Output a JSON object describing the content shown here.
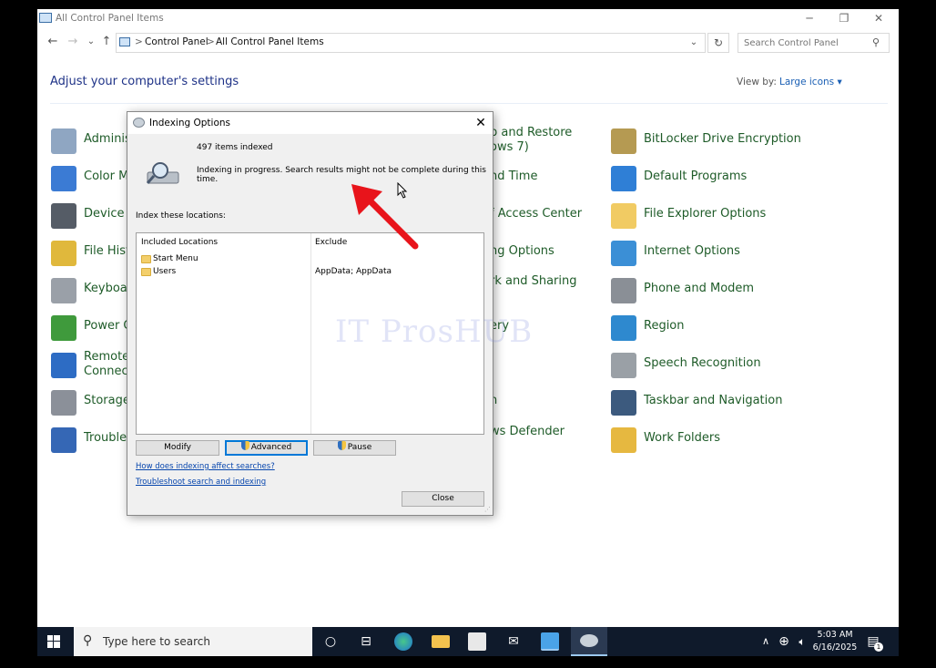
{
  "window": {
    "title": "All Control Panel Items",
    "minimize": "─",
    "restore": "❐",
    "close": "✕"
  },
  "nav": {
    "back": "←",
    "forward": "→",
    "recent": "⌄",
    "up": "↑",
    "breadcrumb": [
      "Control Panel",
      "All Control Panel Items"
    ],
    "separator": ">",
    "search_placeholder": "Search Control Panel"
  },
  "main": {
    "heading": "Adjust your computer's settings",
    "view_by_label": "View by:",
    "view_by_value": "Large icons"
  },
  "items_col1": [
    {
      "label": "Adminis",
      "icon": "admin-tools-icon",
      "color": "#8fa6c2"
    },
    {
      "label": "Color M",
      "icon": "color-management-icon",
      "color": "#3b7bd4"
    },
    {
      "label": "Device M",
      "icon": "device-manager-icon",
      "color": "#555c66"
    },
    {
      "label": "File Histo",
      "icon": "file-history-icon",
      "color": "#e0b83c"
    },
    {
      "label": "Keyboar",
      "icon": "keyboard-icon",
      "color": "#9aa0a8"
    },
    {
      "label": "Power O",
      "icon": "power-options-icon",
      "color": "#3f9a3c"
    },
    {
      "label": "RemoteA\nConnect",
      "icon": "remoteapp-icon",
      "color": "#2d6cc4"
    },
    {
      "label": "Storage",
      "icon": "storage-spaces-icon",
      "color": "#8b9099"
    },
    {
      "label": "Troubles",
      "icon": "troubleshooting-icon",
      "color": "#3567b5"
    }
  ],
  "items_col2": [
    {
      "label": "p and Restore\nows 7)"
    },
    {
      "label": "nd Time"
    },
    {
      "label": "f Access Center"
    },
    {
      "label": "ng Options"
    },
    {
      "label": "rk and Sharing"
    },
    {
      "label": "ery"
    },
    {
      "label": "n"
    },
    {
      "label": "ws Defender\nl"
    }
  ],
  "items_col3": [
    {
      "label": "BitLocker Drive Encryption",
      "icon": "bitlocker-icon",
      "color": "#b59a52"
    },
    {
      "label": "Default Programs",
      "icon": "default-programs-icon",
      "color": "#2f7fd6"
    },
    {
      "label": "File Explorer Options",
      "icon": "folder-options-icon",
      "color": "#f1cb63"
    },
    {
      "label": "Internet Options",
      "icon": "internet-options-icon",
      "color": "#3b8fd6"
    },
    {
      "label": "Phone and Modem",
      "icon": "phone-modem-icon",
      "color": "#8a8f96"
    },
    {
      "label": "Region",
      "icon": "region-icon",
      "color": "#2e89cf"
    },
    {
      "label": "Speech Recognition",
      "icon": "microphone-icon",
      "color": "#9aa0a6"
    },
    {
      "label": "Taskbar and Navigation",
      "icon": "taskbar-icon",
      "color": "#3c5a7e"
    },
    {
      "label": "Work Folders",
      "icon": "work-folders-icon",
      "color": "#e6b840"
    }
  ],
  "dialog": {
    "title": "Indexing Options",
    "items_indexed": "497 items indexed",
    "status": "Indexing in progress. Search results might not be complete during this time.",
    "index_label": "Index these locations:",
    "col_included": "Included Locations",
    "col_exclude": "Exclude",
    "locations": [
      {
        "name": "Start Menu",
        "exclude": ""
      },
      {
        "name": "Users",
        "exclude": "AppData; AppData"
      }
    ],
    "modify": "Modify",
    "advanced": "Advanced",
    "pause": "Pause",
    "link1": "How does indexing affect searches?",
    "link2": "Troubleshoot search and indexing",
    "close": "Close"
  },
  "watermark": "IT ProsHUB",
  "taskbar": {
    "search_placeholder": "Type here to search",
    "time": "5:03 AM",
    "date": "6/16/2025",
    "notification_count": "1"
  },
  "colors": {
    "accent": "#0078d7",
    "link_green": "#1e5b28",
    "arrow": "#e8141b"
  }
}
